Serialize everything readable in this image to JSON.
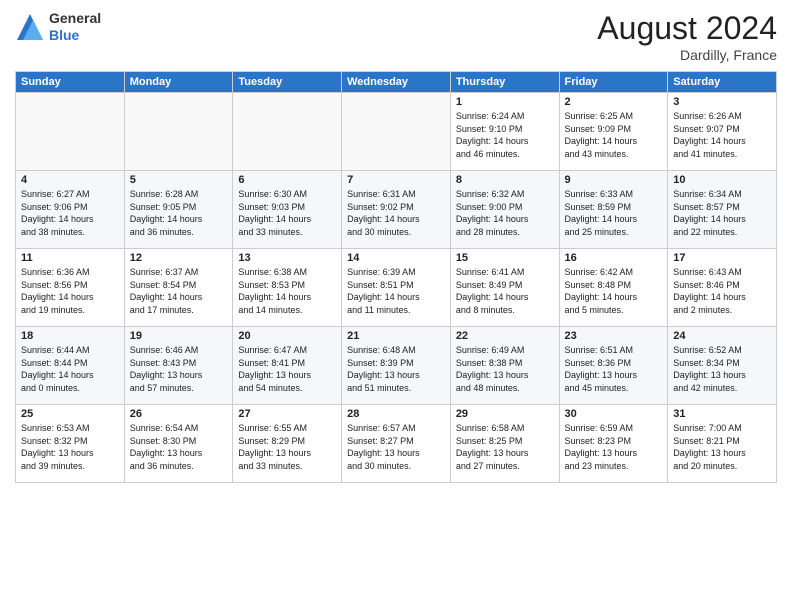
{
  "header": {
    "logo_general": "General",
    "logo_blue": "Blue",
    "month_title": "August 2024",
    "location": "Dardilly, France"
  },
  "days_of_week": [
    "Sunday",
    "Monday",
    "Tuesday",
    "Wednesday",
    "Thursday",
    "Friday",
    "Saturday"
  ],
  "weeks": [
    [
      {
        "day": "",
        "info": ""
      },
      {
        "day": "",
        "info": ""
      },
      {
        "day": "",
        "info": ""
      },
      {
        "day": "",
        "info": ""
      },
      {
        "day": "1",
        "info": "Sunrise: 6:24 AM\nSunset: 9:10 PM\nDaylight: 14 hours\nand 46 minutes."
      },
      {
        "day": "2",
        "info": "Sunrise: 6:25 AM\nSunset: 9:09 PM\nDaylight: 14 hours\nand 43 minutes."
      },
      {
        "day": "3",
        "info": "Sunrise: 6:26 AM\nSunset: 9:07 PM\nDaylight: 14 hours\nand 41 minutes."
      }
    ],
    [
      {
        "day": "4",
        "info": "Sunrise: 6:27 AM\nSunset: 9:06 PM\nDaylight: 14 hours\nand 38 minutes."
      },
      {
        "day": "5",
        "info": "Sunrise: 6:28 AM\nSunset: 9:05 PM\nDaylight: 14 hours\nand 36 minutes."
      },
      {
        "day": "6",
        "info": "Sunrise: 6:30 AM\nSunset: 9:03 PM\nDaylight: 14 hours\nand 33 minutes."
      },
      {
        "day": "7",
        "info": "Sunrise: 6:31 AM\nSunset: 9:02 PM\nDaylight: 14 hours\nand 30 minutes."
      },
      {
        "day": "8",
        "info": "Sunrise: 6:32 AM\nSunset: 9:00 PM\nDaylight: 14 hours\nand 28 minutes."
      },
      {
        "day": "9",
        "info": "Sunrise: 6:33 AM\nSunset: 8:59 PM\nDaylight: 14 hours\nand 25 minutes."
      },
      {
        "day": "10",
        "info": "Sunrise: 6:34 AM\nSunset: 8:57 PM\nDaylight: 14 hours\nand 22 minutes."
      }
    ],
    [
      {
        "day": "11",
        "info": "Sunrise: 6:36 AM\nSunset: 8:56 PM\nDaylight: 14 hours\nand 19 minutes."
      },
      {
        "day": "12",
        "info": "Sunrise: 6:37 AM\nSunset: 8:54 PM\nDaylight: 14 hours\nand 17 minutes."
      },
      {
        "day": "13",
        "info": "Sunrise: 6:38 AM\nSunset: 8:53 PM\nDaylight: 14 hours\nand 14 minutes."
      },
      {
        "day": "14",
        "info": "Sunrise: 6:39 AM\nSunset: 8:51 PM\nDaylight: 14 hours\nand 11 minutes."
      },
      {
        "day": "15",
        "info": "Sunrise: 6:41 AM\nSunset: 8:49 PM\nDaylight: 14 hours\nand 8 minutes."
      },
      {
        "day": "16",
        "info": "Sunrise: 6:42 AM\nSunset: 8:48 PM\nDaylight: 14 hours\nand 5 minutes."
      },
      {
        "day": "17",
        "info": "Sunrise: 6:43 AM\nSunset: 8:46 PM\nDaylight: 14 hours\nand 2 minutes."
      }
    ],
    [
      {
        "day": "18",
        "info": "Sunrise: 6:44 AM\nSunset: 8:44 PM\nDaylight: 14 hours\nand 0 minutes."
      },
      {
        "day": "19",
        "info": "Sunrise: 6:46 AM\nSunset: 8:43 PM\nDaylight: 13 hours\nand 57 minutes."
      },
      {
        "day": "20",
        "info": "Sunrise: 6:47 AM\nSunset: 8:41 PM\nDaylight: 13 hours\nand 54 minutes."
      },
      {
        "day": "21",
        "info": "Sunrise: 6:48 AM\nSunset: 8:39 PM\nDaylight: 13 hours\nand 51 minutes."
      },
      {
        "day": "22",
        "info": "Sunrise: 6:49 AM\nSunset: 8:38 PM\nDaylight: 13 hours\nand 48 minutes."
      },
      {
        "day": "23",
        "info": "Sunrise: 6:51 AM\nSunset: 8:36 PM\nDaylight: 13 hours\nand 45 minutes."
      },
      {
        "day": "24",
        "info": "Sunrise: 6:52 AM\nSunset: 8:34 PM\nDaylight: 13 hours\nand 42 minutes."
      }
    ],
    [
      {
        "day": "25",
        "info": "Sunrise: 6:53 AM\nSunset: 8:32 PM\nDaylight: 13 hours\nand 39 minutes."
      },
      {
        "day": "26",
        "info": "Sunrise: 6:54 AM\nSunset: 8:30 PM\nDaylight: 13 hours\nand 36 minutes."
      },
      {
        "day": "27",
        "info": "Sunrise: 6:55 AM\nSunset: 8:29 PM\nDaylight: 13 hours\nand 33 minutes."
      },
      {
        "day": "28",
        "info": "Sunrise: 6:57 AM\nSunset: 8:27 PM\nDaylight: 13 hours\nand 30 minutes."
      },
      {
        "day": "29",
        "info": "Sunrise: 6:58 AM\nSunset: 8:25 PM\nDaylight: 13 hours\nand 27 minutes."
      },
      {
        "day": "30",
        "info": "Sunrise: 6:59 AM\nSunset: 8:23 PM\nDaylight: 13 hours\nand 23 minutes."
      },
      {
        "day": "31",
        "info": "Sunrise: 7:00 AM\nSunset: 8:21 PM\nDaylight: 13 hours\nand 20 minutes."
      }
    ]
  ]
}
